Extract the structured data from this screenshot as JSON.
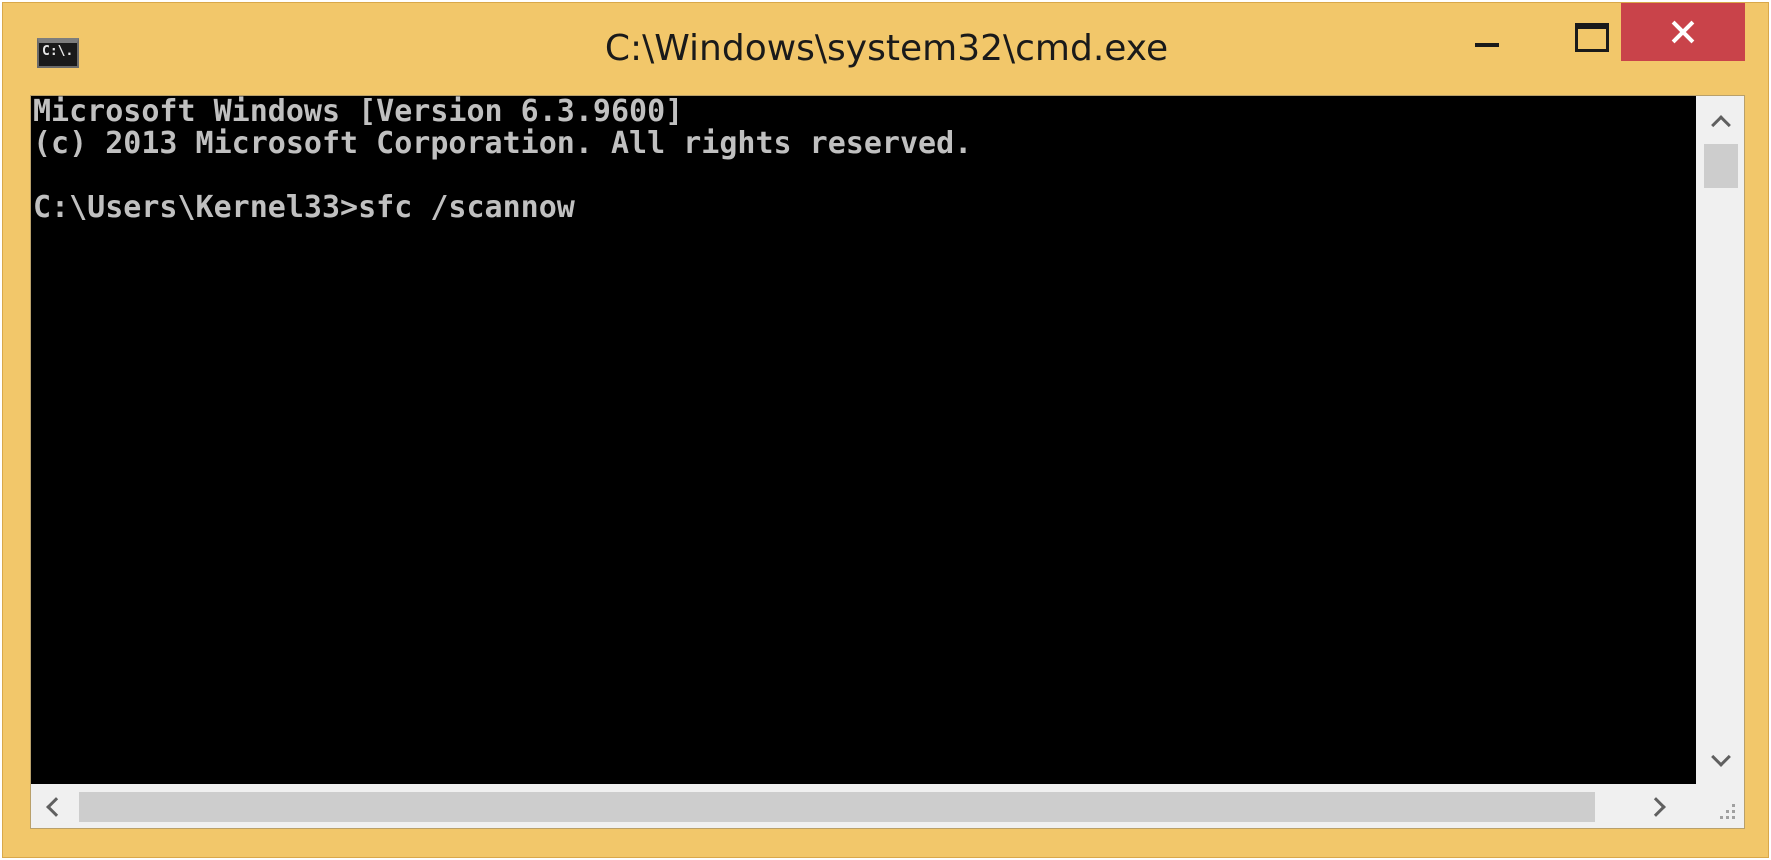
{
  "window": {
    "title": "C:\\Windows\\system32\\cmd.exe",
    "icon_label": "C:\\.",
    "icon": "command-prompt-icon",
    "controls": [
      "minimize-icon",
      "maximize-icon",
      "close-icon"
    ],
    "frame_color": "#f2c76a",
    "close_color": "#c9434a"
  },
  "console": {
    "background": "#000000",
    "foreground": "#c0c0c0",
    "lines": [
      "Microsoft Windows [Version 6.3.9600]",
      "(c) 2013 Microsoft Corporation. All rights reserved.",
      "",
      "C:\\Users\\Kernel33>sfc /scannow"
    ]
  },
  "scrollbars": {
    "vertical_icons": [
      "chevron-up-icon",
      "chevron-down-icon"
    ],
    "horizontal_icons": [
      "chevron-left-icon",
      "chevron-right-icon"
    ]
  }
}
